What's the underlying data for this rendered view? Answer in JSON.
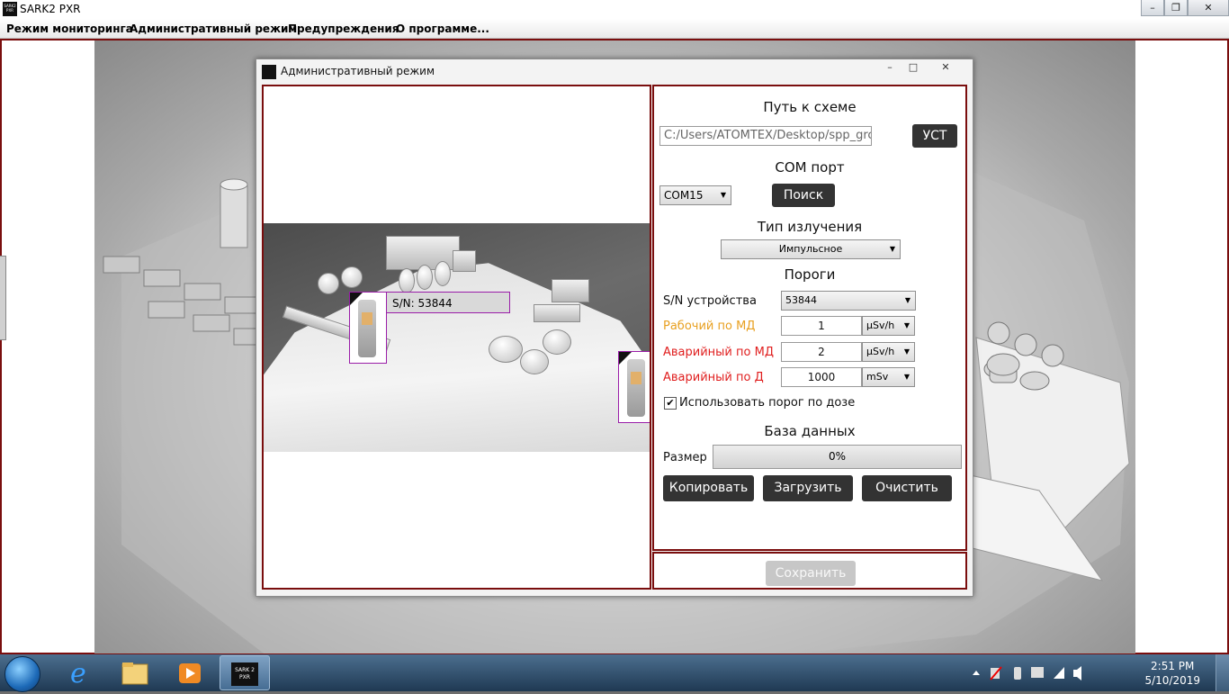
{
  "app": {
    "title": "SARK2 PXR",
    "logo_text": "SARK 2 PXR"
  },
  "window_controls": {
    "minimize": "–",
    "maximize": "❐",
    "close": "✕"
  },
  "menu": [
    "Режим мониторинга",
    "Административный режим",
    "Предупреждения",
    "О программе..."
  ],
  "dialog": {
    "title": "Административный режим",
    "controls": {
      "minimize": "–",
      "maximize": "□",
      "close": "✕"
    }
  },
  "scheme": {
    "sn_label": "S/N: 53844"
  },
  "settings": {
    "path_header": "Путь к схеме",
    "path_value": "C:/Users/ATOMTEX/Desktop/spp_grc",
    "set_button": "УСТ",
    "com_header": "COM порт",
    "com_value": "COM15",
    "search_button": "Поиск",
    "radiation_header": "Тип излучения",
    "radiation_value": "Импульсное",
    "thresholds_header": "Пороги",
    "sn_label": "S/N устройства",
    "sn_value": "53844",
    "work_md_label": "Рабочий по МД",
    "work_md_value": "1",
    "work_md_unit": "μSv/h",
    "alarm_md_label": "Аварийный по МД",
    "alarm_md_value": "2",
    "alarm_md_unit": "μSv/h",
    "alarm_d_label": "Аварийный по Д",
    "alarm_d_value": "1000",
    "alarm_d_unit": "mSv",
    "use_dose_checkbox": "Использовать порог по дозе",
    "use_dose_checked": true,
    "db_header": "База данных",
    "size_label": "Размер",
    "size_progress": "0%",
    "copy_button": "Копировать",
    "load_button": "Загрузить",
    "clear_button": "Очистить",
    "save_button": "Сохранить"
  },
  "colors": {
    "work_md": "#e8a020",
    "alarm": "#e01e1e",
    "border": "#7a0e0e"
  },
  "taskbar": {
    "time": "2:51 PM",
    "date": "5/10/2019",
    "app_label": "SARK 2 PXR",
    "icons": [
      "start-orb-icon",
      "ie-icon",
      "explorer-icon",
      "media-player-icon",
      "sark-app-icon"
    ]
  }
}
